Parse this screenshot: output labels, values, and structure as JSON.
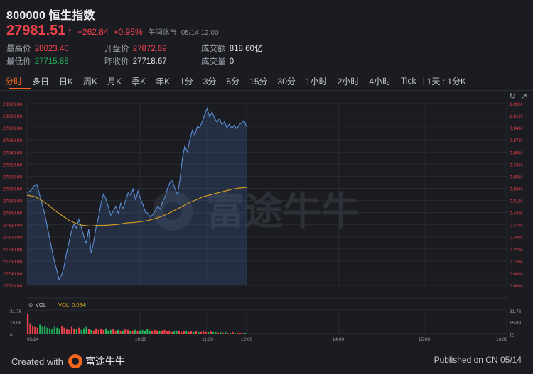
{
  "header": {
    "code": "800000",
    "name": "恒生指数",
    "price": "27981.51",
    "change": "+262.84",
    "change_pct": "+0.95%",
    "status": "午间休市",
    "time": "05/14 12:00"
  },
  "stats": {
    "high_label": "最高价",
    "high": "28023.40",
    "low_label": "最低价",
    "low": "27715.88",
    "open_label": "开盘价",
    "open": "27872.69",
    "prev_label": "昨收价",
    "prev": "27718.67",
    "turnover_label": "成交额",
    "turnover": "818.60亿",
    "volume_label": "成交量",
    "volume": "0"
  },
  "tabs": [
    "分时",
    "多日",
    "日K",
    "周K",
    "月K",
    "季K",
    "年K",
    "1分",
    "3分",
    "5分",
    "15分",
    "30分",
    "1小时",
    "2小时",
    "4小时",
    "Tick",
    "1天 : 1分K"
  ],
  "active_tab": "分时",
  "chart_icons": [
    "reset-zoom-icon",
    "expand-icon"
  ],
  "watermark": "富途牛牛",
  "vol_panel": {
    "label": "VOL",
    "value_label": "VOL: 0.084",
    "left_ticks": [
      "31.76",
      "15.88",
      "0"
    ],
    "right_ticks": [
      "31.76",
      "15.88",
      "亿"
    ]
  },
  "colors": {
    "up": "#f0424a",
    "down": "#23b05a",
    "accent": "#f0661e",
    "line": "#5b8fd6",
    "avg": "#d9a21b"
  },
  "chart_data": {
    "type": "line",
    "x_ticks": [
      "05/14",
      "10:30",
      "11:30",
      "12:00",
      "14:00",
      "15:00",
      "16:00"
    ],
    "y_ticks": [
      "28020.00",
      "28000.00",
      "27980.00",
      "27960.00",
      "27940.00",
      "27920.00",
      "27900.00",
      "27880.00",
      "27860.00",
      "27840.00",
      "27820.00",
      "27800.00",
      "27780.00",
      "27760.00",
      "27740.00",
      "27720.00"
    ],
    "pct_ticks": [
      "1.09%",
      "1.01%",
      "0.94%",
      "0.87%",
      "0.80%",
      "0.73%",
      "0.65%",
      "0.58%",
      "0.51%",
      "0.44%",
      "0.37%",
      "0.30%",
      "0.22%",
      "0.15%",
      "0.08%",
      "0.00%"
    ],
    "ylim": [
      27718.67,
      28020
    ],
    "series": [
      {
        "values": [
          27872.69,
          27874,
          27878,
          27884,
          27886,
          27870,
          27855,
          27840,
          27820,
          27800,
          27780,
          27760,
          27745,
          27728,
          27735,
          27750,
          27772,
          27790,
          27808,
          27820,
          27814,
          27828,
          27815,
          27800,
          27788,
          27812,
          27772,
          27790,
          27815,
          27832,
          27855,
          27870,
          27862,
          27848,
          27835,
          27842,
          27850,
          27838,
          27855,
          27846,
          27860,
          27872,
          27868,
          27878,
          27860,
          27875,
          27862,
          27852,
          27840,
          27838,
          27832,
          27836,
          27842,
          27850,
          27845,
          27858,
          27865,
          27880,
          27890,
          27892,
          27878,
          27870,
          27895,
          27930,
          27950,
          27940,
          27960,
          27976,
          27968,
          27982,
          27980,
          27990,
          28002,
          28012,
          27998,
          28006,
          27996,
          27989,
          27995,
          27985,
          27990,
          27980,
          27986,
          27979,
          27984,
          27978,
          27985,
          27988,
          27992,
          27981.51
        ]
      },
      {
        "values": [
          27868,
          27866,
          27860,
          27852,
          27842,
          27834,
          27826,
          27821,
          27818,
          27817,
          27818,
          27818,
          27819,
          27820,
          27822,
          27823,
          27824,
          27826,
          27829,
          27833,
          27838,
          27844,
          27850,
          27856,
          27861,
          27866,
          27869,
          27872,
          27875,
          27878,
          27880,
          27881
        ]
      }
    ],
    "volume": [
      26,
      14,
      10,
      9,
      8,
      12,
      9,
      10,
      8,
      7,
      6,
      9,
      8,
      7,
      10,
      8,
      6,
      5,
      9,
      7,
      6,
      8,
      5,
      7,
      9,
      6,
      5,
      4,
      7,
      5,
      6,
      5,
      7,
      4,
      5,
      6,
      4,
      5,
      3,
      4,
      6,
      5,
      3,
      4,
      5,
      3,
      4,
      5,
      3,
      6,
      4,
      3,
      5,
      4,
      3,
      4,
      5,
      3,
      4,
      2,
      3,
      4,
      3,
      2,
      3,
      4,
      2,
      3,
      2,
      3,
      2,
      2,
      3,
      2,
      2,
      3,
      2,
      2,
      1,
      2,
      1,
      2,
      1,
      1,
      2,
      1,
      1,
      1,
      1,
      1
    ],
    "volume_ylim": [
      0,
      31.76
    ]
  },
  "footer": {
    "created": "Created with",
    "brand": "富途牛牛",
    "published": "Published on CN 05/14"
  }
}
